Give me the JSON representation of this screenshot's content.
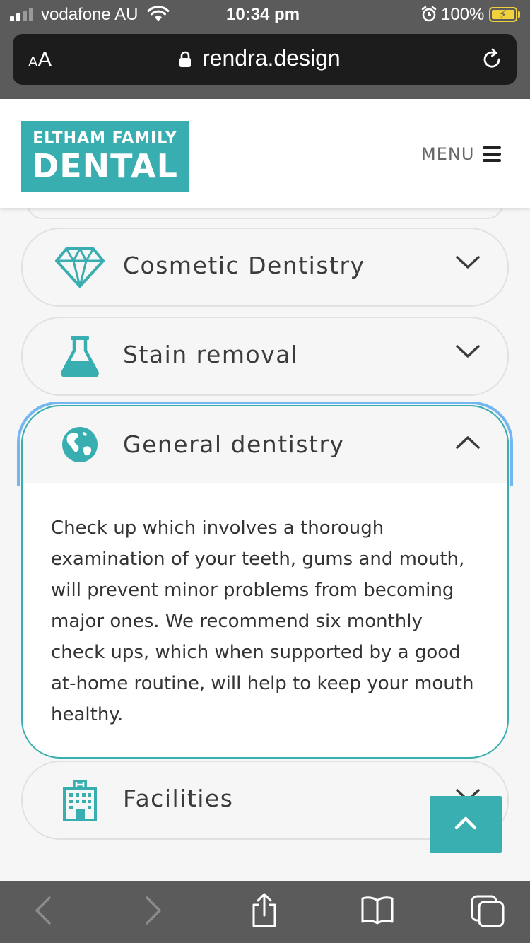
{
  "status_bar": {
    "carrier": "vodafone AU",
    "time": "10:34 pm",
    "battery_percent": "100%"
  },
  "browser": {
    "text_size_small": "A",
    "text_size_big": "A",
    "url": "rendra.design"
  },
  "header": {
    "logo_line1": "ELTHAM FAMILY",
    "logo_line2": "DENTAL",
    "menu_label": "MENU"
  },
  "accordion": {
    "items": [
      {
        "title": "Cosmetic Dentistry",
        "icon": "diamond-icon",
        "expanded": false
      },
      {
        "title": "Stain removal",
        "icon": "flask-icon",
        "expanded": false
      },
      {
        "title": "General dentistry",
        "icon": "globe-icon",
        "expanded": true,
        "body": "Check up which involves a thorough examination of your teeth, gums and mouth, will prevent minor problems from becoming major ones. We recommend six monthly check ups, which when supported by a good at-home routine, will help to keep your mouth healthy."
      },
      {
        "title": "Facilities",
        "icon": "hospital-icon",
        "expanded": false
      }
    ]
  },
  "colors": {
    "teal": "#39aeb1",
    "focus_blue": "#74b6f2",
    "chrome_gray": "#5b5b5b",
    "page_bg": "#f6f6f6"
  },
  "toolbar_icons": [
    "back-icon",
    "forward-icon",
    "share-icon",
    "bookmarks-icon",
    "tabs-icon"
  ]
}
